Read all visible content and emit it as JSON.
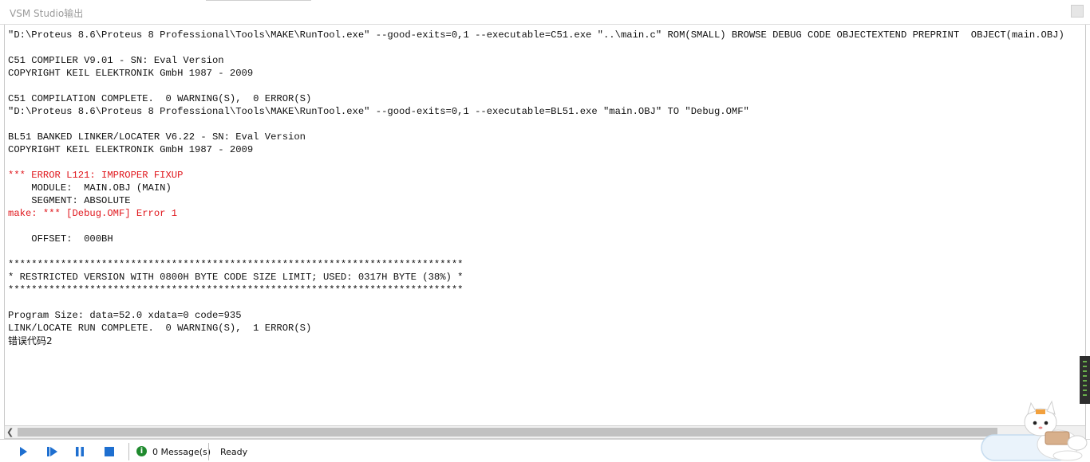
{
  "window": {
    "title": "VSM Studio输出"
  },
  "output": {
    "lines": [
      {
        "text": "\"D:\\Proteus 8.6\\Proteus 8 Professional\\Tools\\MAKE\\RunTool.exe\" --good-exits=0,1 --executable=C51.exe \"..\\main.c\" ROM(SMALL) BROWSE DEBUG CODE OBJECTEXTEND PREPRINT  OBJECT(main.OBJ)",
        "type": "normal"
      },
      {
        "text": "",
        "type": "normal"
      },
      {
        "text": "C51 COMPILER V9.01 - SN: Eval Version",
        "type": "normal"
      },
      {
        "text": "COPYRIGHT KEIL ELEKTRONIK GmbH 1987 - 2009",
        "type": "normal"
      },
      {
        "text": "",
        "type": "normal"
      },
      {
        "text": "C51 COMPILATION COMPLETE.  0 WARNING(S),  0 ERROR(S)",
        "type": "normal"
      },
      {
        "text": "\"D:\\Proteus 8.6\\Proteus 8 Professional\\Tools\\MAKE\\RunTool.exe\" --good-exits=0,1 --executable=BL51.exe \"main.OBJ\" TO \"Debug.OMF\"",
        "type": "normal"
      },
      {
        "text": "",
        "type": "normal"
      },
      {
        "text": "BL51 BANKED LINKER/LOCATER V6.22 - SN: Eval Version",
        "type": "normal"
      },
      {
        "text": "COPYRIGHT KEIL ELEKTRONIK GmbH 1987 - 2009",
        "type": "normal"
      },
      {
        "text": "",
        "type": "normal"
      },
      {
        "text": "*** ERROR L121: IMPROPER FIXUP",
        "type": "error"
      },
      {
        "text": "    MODULE:  MAIN.OBJ (MAIN)",
        "type": "normal"
      },
      {
        "text": "    SEGMENT: ABSOLUTE",
        "type": "normal"
      },
      {
        "text": "make: *** [Debug.OMF] Error 1",
        "type": "error"
      },
      {
        "text": "",
        "type": "normal"
      },
      {
        "text": "    OFFSET:  000BH",
        "type": "normal"
      },
      {
        "text": "",
        "type": "normal"
      },
      {
        "text": "******************************************************************************",
        "type": "normal"
      },
      {
        "text": "* RESTRICTED VERSION WITH 0800H BYTE CODE SIZE LIMIT; USED: 0317H BYTE (38%) *",
        "type": "normal"
      },
      {
        "text": "******************************************************************************",
        "type": "normal"
      },
      {
        "text": "",
        "type": "normal"
      },
      {
        "text": "Program Size: data=52.0 xdata=0 code=935",
        "type": "normal"
      },
      {
        "text": "LINK/LOCATE RUN COMPLETE.  0 WARNING(S),  1 ERROR(S)",
        "type": "normal"
      },
      {
        "text": "错误代码2",
        "type": "cjk"
      }
    ]
  },
  "statusbar": {
    "messages_label": "0 Message(s)",
    "status": "Ready"
  },
  "colors": {
    "error_text": "#e0171d",
    "control_blue": "#1e6fd0",
    "info_green": "#1f8a2e"
  },
  "icons": [
    "play-icon",
    "step-icon",
    "pause-icon",
    "stop-icon",
    "info-icon",
    "scroll-left-icon",
    "close-icon"
  ]
}
